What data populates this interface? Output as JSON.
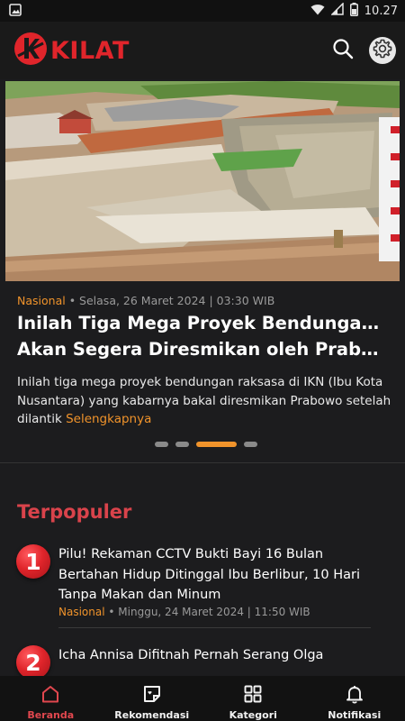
{
  "status_bar": {
    "time": "10.27",
    "icons": [
      "gallery-icon",
      "wifi-icon",
      "signal-icon",
      "battery-icon"
    ]
  },
  "header": {
    "logo_text": "KILAT",
    "icons": [
      "search-icon",
      "settings-icon"
    ]
  },
  "hero": {
    "image": "dam-construction-photo",
    "category": "Nasional",
    "separator": "•",
    "date": "Selasa, 26 Maret 2024 | 03:30 WIB",
    "title_line1": "Inilah Tiga Mega Proyek Bendungan di IKN,",
    "title_line2": "Akan Segera Diresmikan oleh Prabowo Se...",
    "excerpt": "Inilah tiga mega proyek bendungan raksasa di IKN (Ibu Kota Nusantara) yang kabarnya bakal diresmikan Prabowo setelah dilantik",
    "read_more": "Selengkapnya",
    "pager": {
      "count": 4,
      "active_index": 2
    }
  },
  "popular": {
    "section_title": "Terpopuler",
    "items": [
      {
        "rank": "1",
        "title": "Pilu! Rekaman CCTV Bukti Bayi 16 Bulan Bertahan Hidup Ditinggal Ibu Berlibur, 10 Hari Tanpa Makan dan Minum",
        "category": "Nasional",
        "separator": "•",
        "date": "Minggu, 24 Maret 2024 | 11:50 WIB"
      },
      {
        "rank": "2",
        "title": "Icha Annisa Difitnah Pernah Serang Olga"
      }
    ]
  },
  "bottom_nav": {
    "items": [
      {
        "label": "Beranda",
        "icon": "home-icon",
        "active": true
      },
      {
        "label": "Rekomendasi",
        "icon": "recommendation-icon",
        "active": false
      },
      {
        "label": "Kategori",
        "icon": "grid-icon",
        "active": false
      },
      {
        "label": "Notifikasi",
        "icon": "bell-icon",
        "active": false
      }
    ]
  },
  "colors": {
    "accent": "#f0932b",
    "brand": "#e0252b",
    "section_title": "#d9434b",
    "background": "#1c1c1e"
  }
}
